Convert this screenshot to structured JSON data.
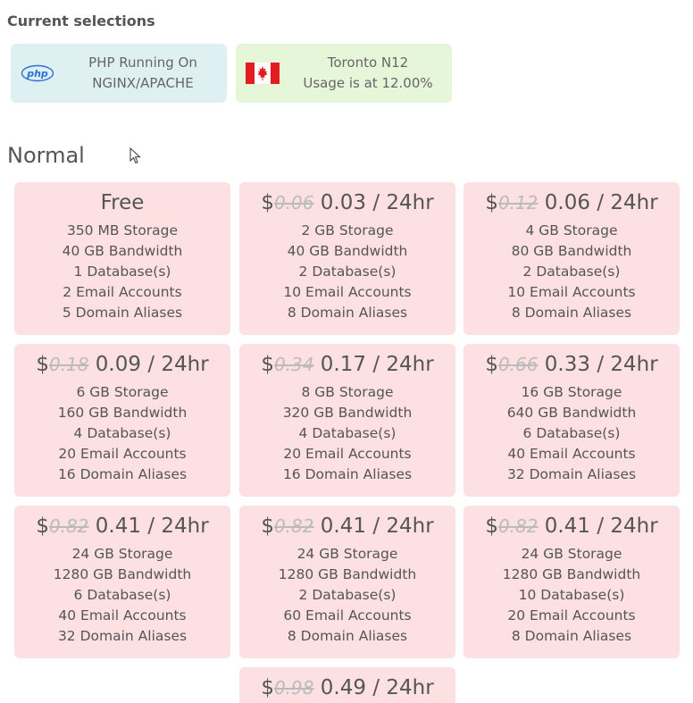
{
  "header": {
    "title": "Current selections"
  },
  "selections": {
    "php": {
      "icon": "php-logo-icon",
      "logo_text": "php",
      "line1": "PHP Running On",
      "line2": "NGINX/APACHE"
    },
    "location": {
      "icon": "canada-flag-icon",
      "line1": "Toronto N12",
      "line2": "Usage is at 12.00%"
    }
  },
  "section": {
    "title": "Normal"
  },
  "plans": [
    {
      "price_free": "Free",
      "features": [
        "350 MB Storage",
        "40 GB Bandwidth",
        "1 Database(s)",
        "2 Email Accounts",
        "5 Domain Aliases"
      ]
    },
    {
      "currency": "$",
      "old_price": "0.06",
      "new_price": "0.03 / 24hr",
      "features": [
        "2 GB Storage",
        "40 GB Bandwidth",
        "2 Database(s)",
        "10 Email Accounts",
        "8 Domain Aliases"
      ]
    },
    {
      "currency": "$",
      "old_price": "0.12",
      "new_price": "0.06 / 24hr",
      "features": [
        "4 GB Storage",
        "80 GB Bandwidth",
        "2 Database(s)",
        "10 Email Accounts",
        "8 Domain Aliases"
      ]
    },
    {
      "currency": "$",
      "old_price": "0.18",
      "new_price": "0.09 / 24hr",
      "features": [
        "6 GB Storage",
        "160 GB Bandwidth",
        "4 Database(s)",
        "20 Email Accounts",
        "16 Domain Aliases"
      ]
    },
    {
      "currency": "$",
      "old_price": "0.34",
      "new_price": "0.17 / 24hr",
      "features": [
        "8 GB Storage",
        "320 GB Bandwidth",
        "4 Database(s)",
        "20 Email Accounts",
        "16 Domain Aliases"
      ]
    },
    {
      "currency": "$",
      "old_price": "0.66",
      "new_price": "0.33 / 24hr",
      "features": [
        "16 GB Storage",
        "640 GB Bandwidth",
        "6 Database(s)",
        "40 Email Accounts",
        "32 Domain Aliases"
      ]
    },
    {
      "currency": "$",
      "old_price": "0.82",
      "new_price": "0.41 / 24hr",
      "features": [
        "24 GB Storage",
        "1280 GB Bandwidth",
        "6 Database(s)",
        "40 Email Accounts",
        "32 Domain Aliases"
      ]
    },
    {
      "currency": "$",
      "old_price": "0.82",
      "new_price": "0.41 / 24hr",
      "features": [
        "24 GB Storage",
        "1280 GB Bandwidth",
        "2 Database(s)",
        "60 Email Accounts",
        "8 Domain Aliases"
      ]
    },
    {
      "currency": "$",
      "old_price": "0.82",
      "new_price": "0.41 / 24hr",
      "features": [
        "24 GB Storage",
        "1280 GB Bandwidth",
        "10 Database(s)",
        "20 Email Accounts",
        "8 Domain Aliases"
      ]
    },
    {
      "currency": "$",
      "old_price": "0.98",
      "new_price": "0.49 / 24hr",
      "features": []
    }
  ],
  "colors": {
    "plan_bg": "#fde0e2",
    "php_bg": "#dff0f2",
    "location_bg": "#e6f6d9",
    "flag_red": "#e31b23"
  }
}
